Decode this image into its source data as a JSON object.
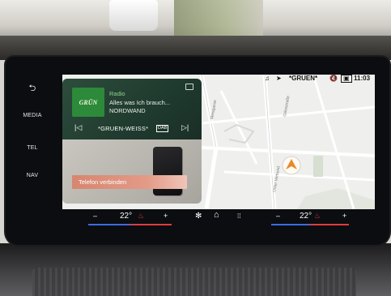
{
  "side_nav": {
    "back_icon": "⮌",
    "media": "MEDIA",
    "tel": "TEL",
    "nav": "NAV"
  },
  "status": {
    "bluetooth_icon": "♫",
    "nav_icon": "➤",
    "station": "*GRUEN*",
    "mute_icon": "🔇",
    "screen_icon": "▣",
    "time": "11:03"
  },
  "radio": {
    "logo_text": "GRÜN",
    "source": "Radio",
    "track": "Alles was Ich brauch...",
    "artist": "NORDWAND",
    "prev_icon": "|◁",
    "next_icon": "▷|",
    "station_name": "*GRUEN-WEISS*",
    "band": "DAB"
  },
  "phone": {
    "connect_label": "Telefon verbinden"
  },
  "map": {
    "street_1": "Meisgasse",
    "street_2": "Gänsstraße",
    "street_3": "Unter Verbund"
  },
  "climate": {
    "minus_left": "–",
    "temp_left": "22°",
    "seat_heat_icon": "♨",
    "plus_left": "+",
    "fan_icon": "✻",
    "home_icon": "⌂",
    "apps_icon": "⁞⁞",
    "minus_right": "–",
    "temp_right": "22°",
    "plus_right": "+"
  },
  "colors": {
    "accent_heat": "#e43a3a",
    "accent_cool": "#3a6be3",
    "radio_green": "#2c8a3a",
    "phone_button": "#e39a87"
  }
}
